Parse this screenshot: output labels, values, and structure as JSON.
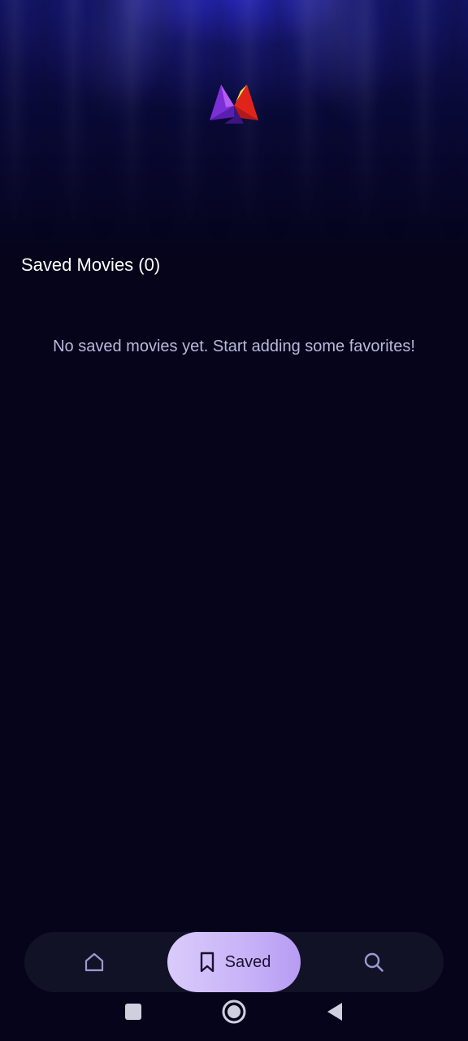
{
  "header": {
    "logo_icon": "app-logo-icon"
  },
  "saved": {
    "title": "Saved Movies (0)",
    "empty_message": "No saved movies yet. Start adding some favorites!"
  },
  "bottom_nav": {
    "items": [
      {
        "id": "home",
        "icon": "home-icon",
        "label": ""
      },
      {
        "id": "saved",
        "icon": "bookmark-icon",
        "label": "Saved",
        "active": true
      },
      {
        "id": "search",
        "icon": "search-icon",
        "label": ""
      }
    ],
    "active_color": "#c7b2f8"
  },
  "system_nav": {
    "recents_icon": "square-icon",
    "home_icon": "circle-home-icon",
    "back_icon": "back-triangle-icon"
  }
}
